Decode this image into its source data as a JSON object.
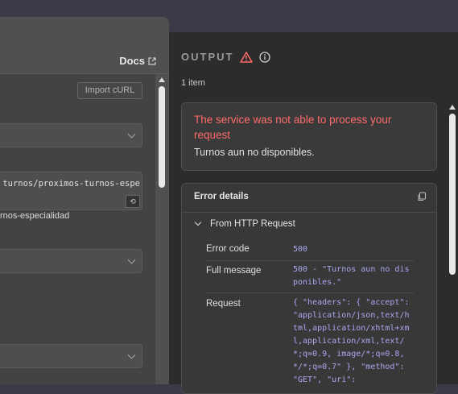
{
  "left": {
    "docs_label": "Docs",
    "import_label": "Import cURL",
    "url_value": "turnos/proximos-turnos-espe",
    "url_hint": "rnos-especialidad"
  },
  "output": {
    "title": "OUTPUT",
    "items_count": "1 item",
    "error_title": "The service was not able to process your request",
    "error_message": "Turnos aun no disponibles.",
    "details_title": "Error details",
    "source_label": "From HTTP Request",
    "fields": [
      {
        "label": "Error code",
        "value": "500"
      },
      {
        "label": "Full message",
        "value": "500 - \"Turnos aun no disponibles.\""
      },
      {
        "label": "Request",
        "value": "{ \"headers\": { \"accept\": \"application/json,text/html,application/xhtml+xml,application/xml,text/*;q=0.9, image/*;q=0.8, */*;q=0.7\" }, \"method\": \"GET\", \"uri\":"
      }
    ]
  },
  "colors": {
    "error": "#ff6b6b",
    "value": "#a9a9f0"
  }
}
